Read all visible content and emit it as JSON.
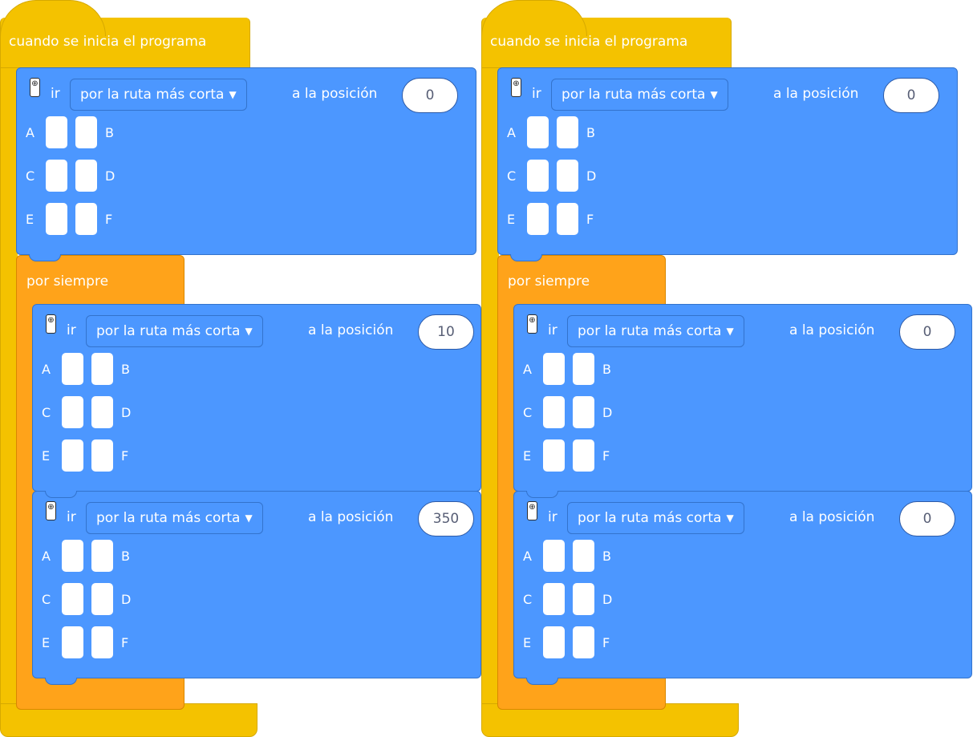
{
  "stacks": [
    {
      "hat_label": "cuando se inicia el programa",
      "forever_label": "por siempre",
      "init_block": {
        "ir": "ir",
        "route": "por la ruta más corta",
        "to_pos": "a la posición",
        "value": "0"
      },
      "loop_blocks": [
        {
          "ir": "ir",
          "route": "por la ruta más corta",
          "to_pos": "a la posición",
          "value": "10"
        },
        {
          "ir": "ir",
          "route": "por la ruta más corta",
          "to_pos": "a la posición",
          "value": "350"
        }
      ]
    },
    {
      "hat_label": "cuando se inicia el programa",
      "forever_label": "por siempre",
      "init_block": {
        "ir": "ir",
        "route": "por la ruta más corta",
        "to_pos": "a la posición",
        "value": "0"
      },
      "loop_blocks": [
        {
          "ir": "ir",
          "route": "por la ruta más corta",
          "to_pos": "a la posición",
          "value": "0"
        },
        {
          "ir": "ir",
          "route": "por la ruta más corta",
          "to_pos": "a la posición",
          "value": "0"
        }
      ]
    }
  ],
  "ports": {
    "a": "A",
    "b": "B",
    "c": "C",
    "d": "D",
    "e": "E",
    "f": "F"
  },
  "icons": {
    "motor": "motor-icon",
    "dropdown": "caret-down-icon"
  },
  "colors": {
    "events": "#f4c200",
    "control": "#ffa31a",
    "motors": "#4c97ff"
  }
}
